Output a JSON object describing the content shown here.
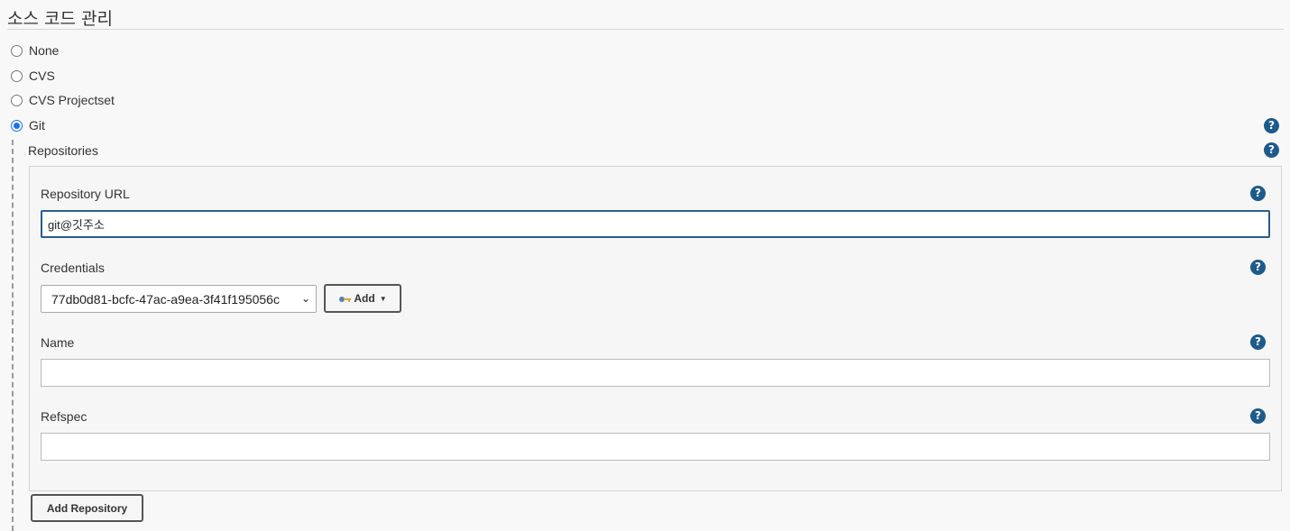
{
  "section": {
    "title": "소스 코드 관리"
  },
  "scm_options": [
    {
      "label": "None",
      "selected": false
    },
    {
      "label": "CVS",
      "selected": false
    },
    {
      "label": "CVS Projectset",
      "selected": false
    },
    {
      "label": "Git",
      "selected": true
    }
  ],
  "git": {
    "help_icon": "?",
    "repositories_label": "Repositories",
    "repository": {
      "url_label": "Repository URL",
      "url_value": "git@깃주소",
      "credentials_label": "Credentials",
      "credentials_value": "77db0d81-bcfc-47ac-a9ea-3f41f195056c",
      "credentials_caret": "⌄",
      "add_label": "Add",
      "add_caret": "▼",
      "name_label": "Name",
      "name_value": "",
      "refspec_label": "Refspec",
      "refspec_value": ""
    },
    "add_repository_label": "Add Repository"
  },
  "icons": {
    "help": "help-circle-icon",
    "key": "key-icon"
  },
  "colors": {
    "help_bg": "#1e5a8a",
    "radio_selected": "#1a73e8",
    "focus_border": "#2a5d8f"
  }
}
